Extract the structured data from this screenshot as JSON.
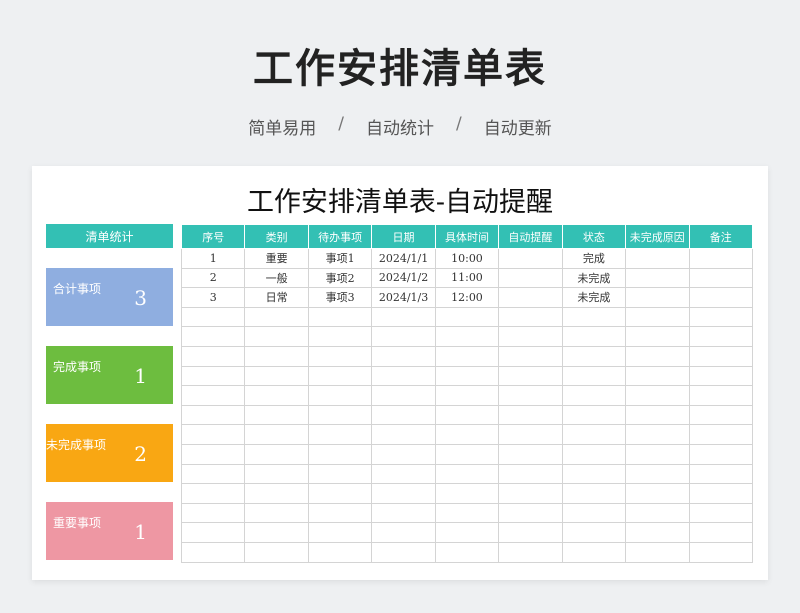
{
  "page": {
    "title": "工作安排清单表",
    "subtitle_items": [
      "简单易用",
      "/",
      "自动统计",
      "/",
      "自动更新"
    ]
  },
  "sheet": {
    "title": "工作安排清单表-自动提醒",
    "stats": {
      "header": "清单统计",
      "cards": [
        {
          "label": "合计事项",
          "value": "3",
          "color": "#8faee0"
        },
        {
          "label": "完成事项",
          "value": "1",
          "color": "#6dbd3f"
        },
        {
          "label": "未完成事项",
          "value": "2",
          "color": "#f9a713"
        },
        {
          "label": "重要事项",
          "value": "1",
          "color": "#ee97a3"
        }
      ]
    },
    "table": {
      "header_color": "#33c0b4",
      "columns": [
        "序号",
        "类别",
        "待办事项",
        "日期",
        "具体时间",
        "自动提醒",
        "状态",
        "未完成原因",
        "备注"
      ],
      "rows": [
        [
          "1",
          "重要",
          "事项1",
          "2024/1/1",
          "10:00",
          "",
          "完成",
          "",
          ""
        ],
        [
          "2",
          "一般",
          "事项2",
          "2024/1/2",
          "11:00",
          "",
          "未完成",
          "",
          ""
        ],
        [
          "3",
          "日常",
          "事项3",
          "2024/1/3",
          "12:00",
          "",
          "未完成",
          "",
          ""
        ]
      ],
      "empty_row_count": 13
    }
  }
}
